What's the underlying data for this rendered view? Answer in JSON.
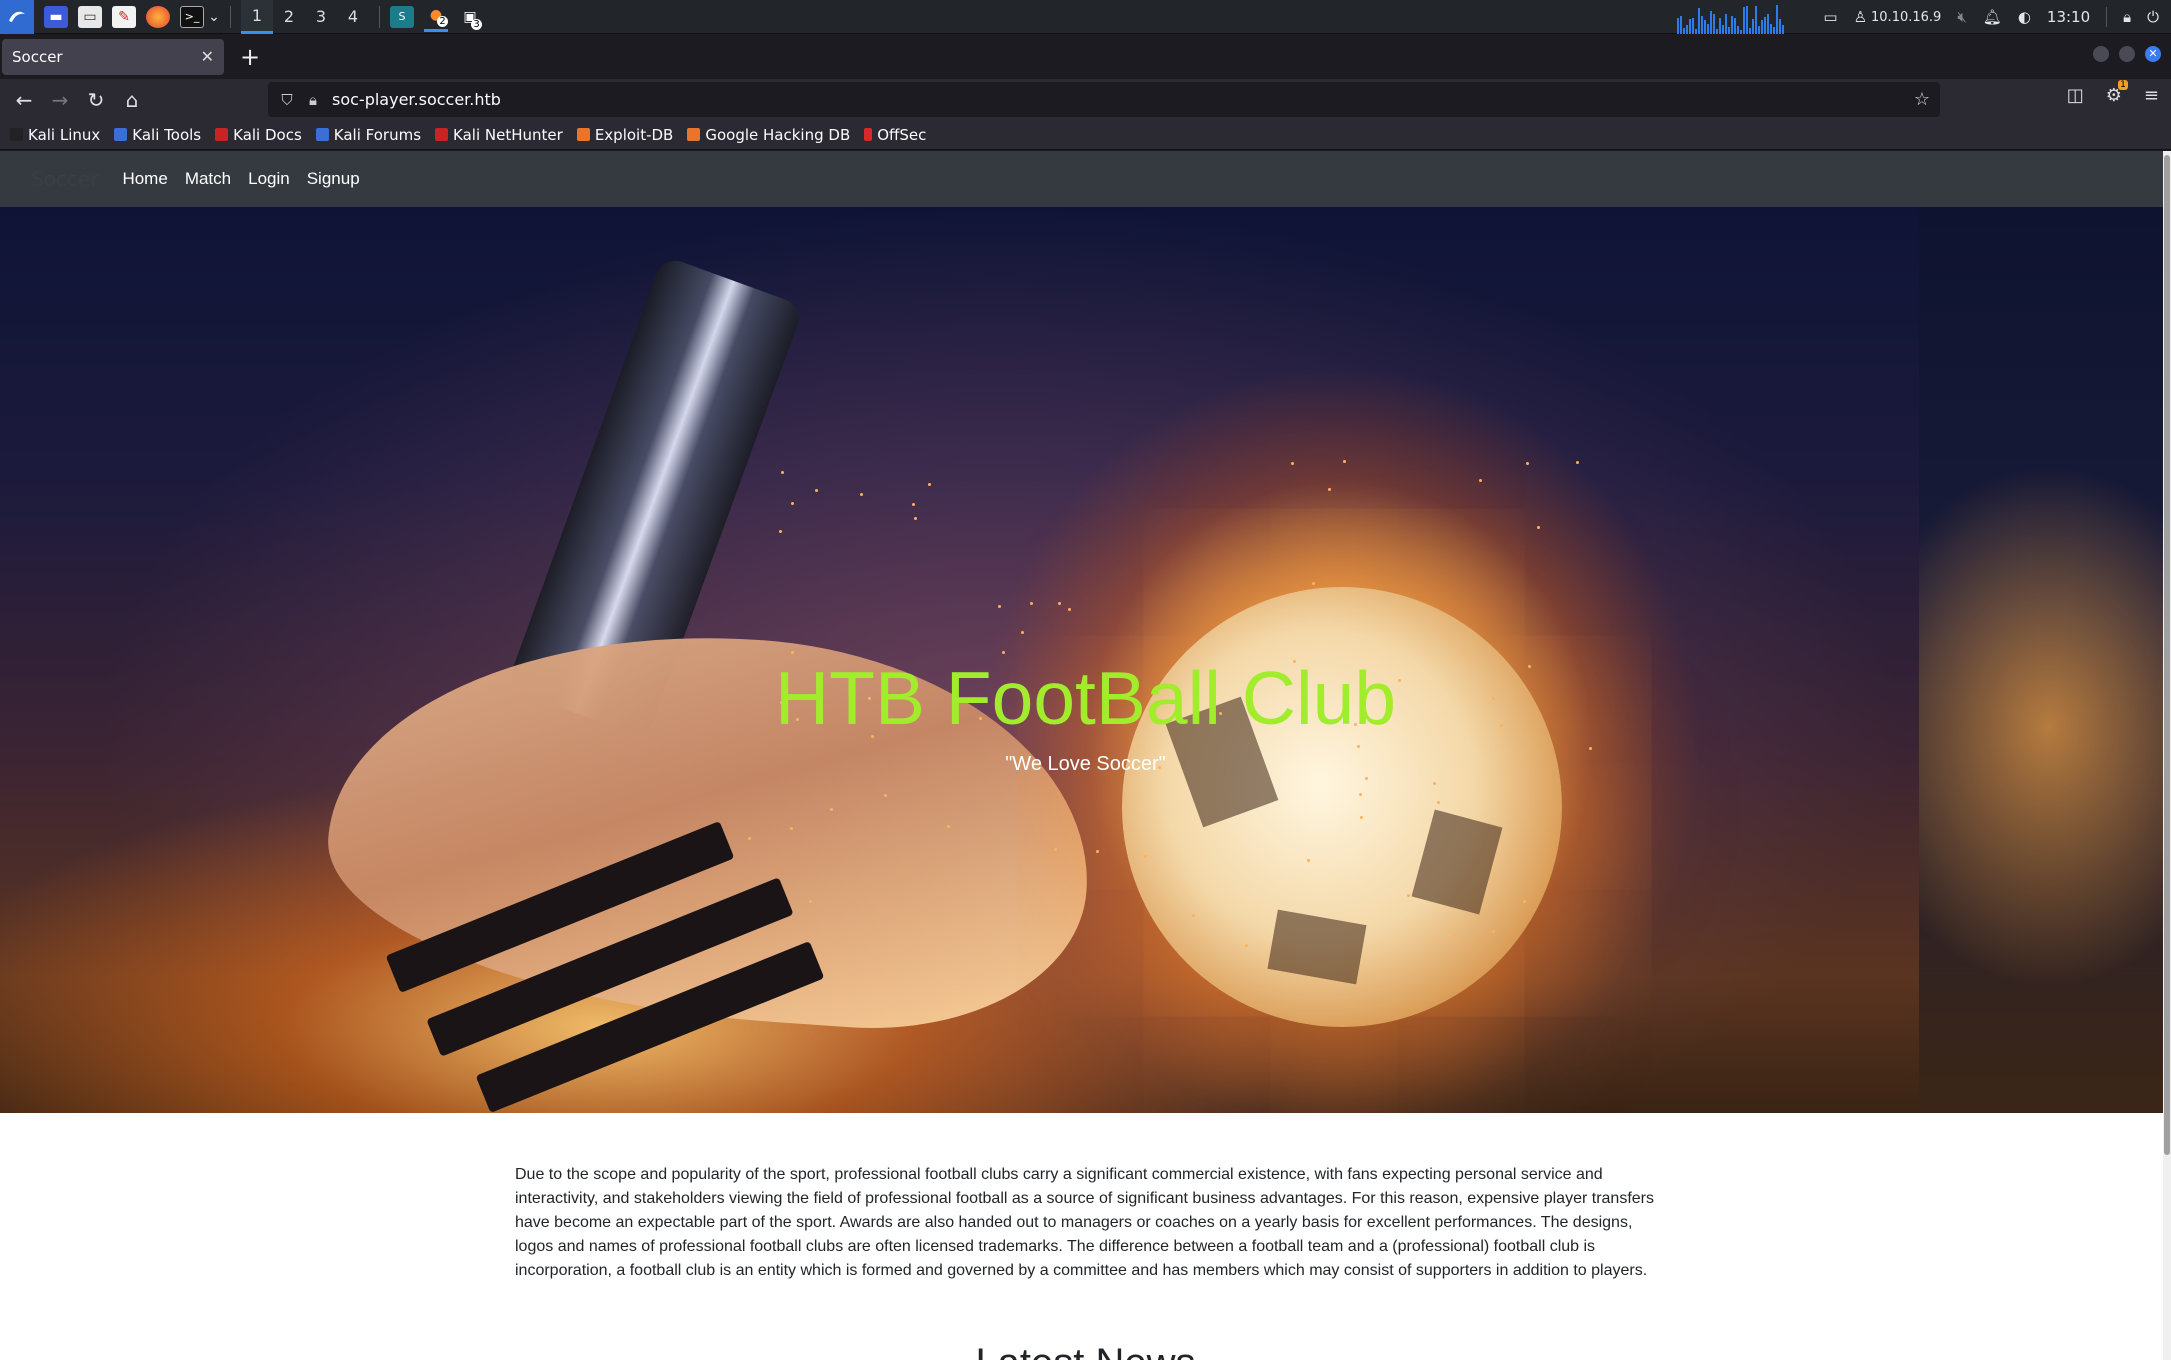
{
  "taskbar": {
    "workspaces": [
      "1",
      "2",
      "3",
      "4"
    ],
    "ip": "10.10.16.9",
    "clock": "13:10",
    "badge_a": "2",
    "badge_b": "3"
  },
  "browser": {
    "tab_title": "Soccer",
    "url": "soc-player.soccer.htb",
    "extension_badge": "1",
    "bookmarks": [
      "Kali Linux",
      "Kali Tools",
      "Kali Docs",
      "Kali Forums",
      "Kali NetHunter",
      "Exploit-DB",
      "Google Hacking DB",
      "OffSec"
    ]
  },
  "site": {
    "brand": "Soccer",
    "nav": [
      "Home",
      "Match",
      "Login",
      "Signup"
    ],
    "hero_title": "HTB FootBall Club",
    "hero_subtitle": "\"We Love Soccer\"",
    "about": "Due to the scope and popularity of the sport, professional football clubs carry a significant commercial existence, with fans expecting personal service and interactivity, and stakeholders viewing the field of professional football as a source of significant business advantages. For this reason, expensive player transfers have become an expectable part of the sport. Awards are also handed out to managers or coaches on a yearly basis for excellent performances. The designs, logos and names of professional football clubs are often licensed trademarks. The difference between a football team and a (professional) football club is incorporation, a football club is an entity which is formed and governed by a committee and has members which may consist of supporters in addition to players.",
    "news_heading": "Latest News"
  },
  "colors": {
    "hero_title": "#a1ec2b",
    "navbar": "#343a40",
    "accent": "#3a8fe8"
  }
}
